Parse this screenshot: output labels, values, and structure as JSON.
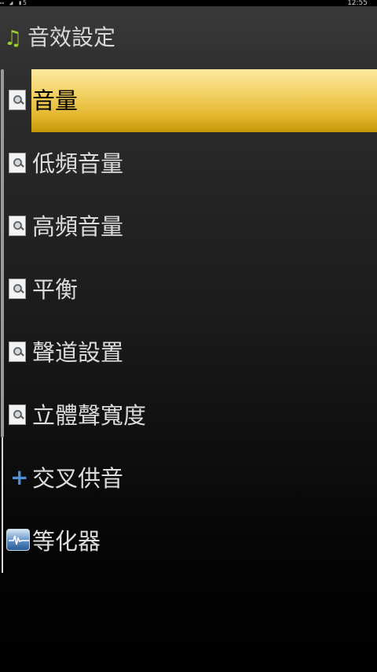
{
  "status_bar": {
    "left_glyphs": "▭ ◢ ▮5",
    "time": "12:55"
  },
  "title_bar": {
    "icon": "music-note-icon",
    "icon_color": "#9acd32",
    "title": "音效設定"
  },
  "list": {
    "highlight_color": "#e2b62b",
    "items": [
      {
        "label": "音量",
        "icon": "settings-document-icon",
        "selected": true
      },
      {
        "label": "低頻音量",
        "icon": "settings-document-icon",
        "selected": false
      },
      {
        "label": "高頻音量",
        "icon": "settings-document-icon",
        "selected": false
      },
      {
        "label": "平衡",
        "icon": "settings-document-icon",
        "selected": false
      },
      {
        "label": "聲道設置",
        "icon": "settings-document-icon",
        "selected": false
      },
      {
        "label": "立體聲寬度",
        "icon": "settings-document-icon",
        "selected": false
      },
      {
        "label": "交叉供音",
        "icon": "plus-icon",
        "selected": false
      },
      {
        "label": "等化器",
        "icon": "equalizer-icon",
        "selected": false
      }
    ]
  }
}
